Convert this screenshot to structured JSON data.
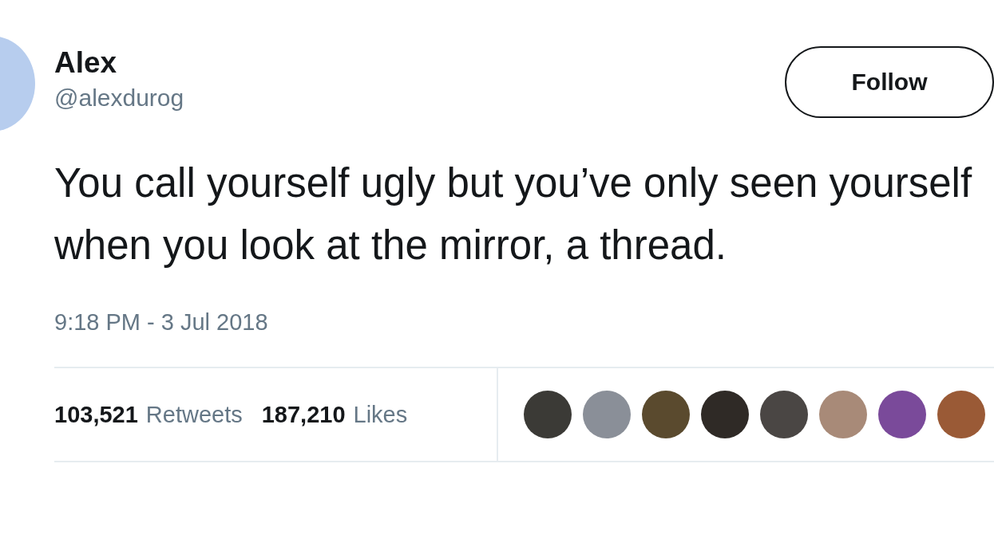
{
  "author": {
    "name": "Alex",
    "handle": "@alexdurog"
  },
  "follow_button": {
    "label": "Follow"
  },
  "tweet": {
    "text": "You call yourself ugly but you’ve only seen yourself when you look at the mirror, a thread.",
    "timestamp": "9:18 PM - 3 Jul 2018"
  },
  "stats": [
    {
      "count": "103,521",
      "label": "Retweets"
    },
    {
      "count": "187,210",
      "label": "Likes"
    }
  ]
}
